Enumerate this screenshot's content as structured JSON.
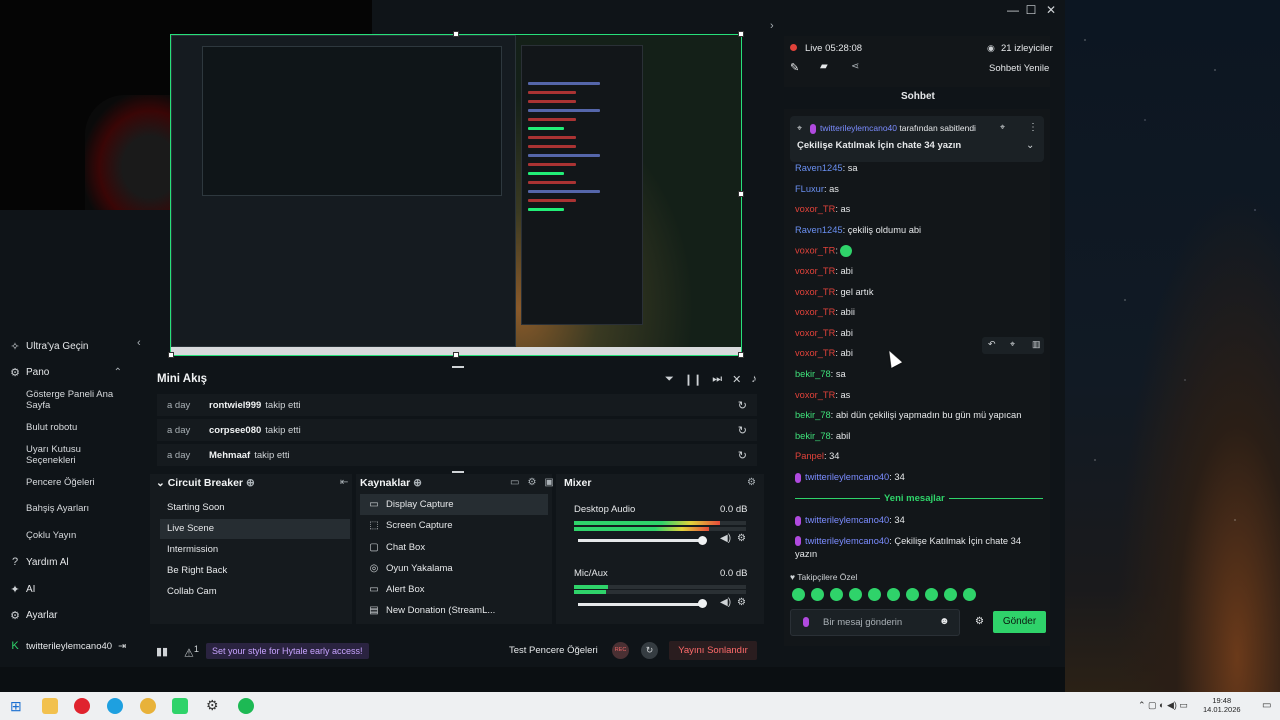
{
  "window": {
    "minimize": "—",
    "maximize": "☐",
    "close": "✕"
  },
  "sidebar": {
    "ultra": "Ultra'ya Geçin",
    "pano": "Pano",
    "sub_items": [
      "Gösterge Paneli Ana Sayfa",
      "Bulut robotu",
      "Uyarı Kutusu Seçenekleri",
      "Pencere Öğeleri",
      "Bahşiş Ayarları",
      "Çoklu Yayın"
    ],
    "help": "Yardım Al",
    "ai": "AI",
    "settings": "Ayarlar",
    "account": "twitterileylemcano40"
  },
  "mini_feed": {
    "title": "Mini Akış",
    "rows": [
      {
        "when": "a day",
        "user": "rontwiel999",
        "action": "takip etti"
      },
      {
        "when": "a day",
        "user": "corpsee080",
        "action": "takip etti"
      },
      {
        "when": "a day",
        "user": "Mehmaaf",
        "action": "takip etti"
      }
    ]
  },
  "scenes": {
    "title": "Circuit Breaker",
    "items": [
      "Starting Soon",
      "Live Scene",
      "Intermission",
      "Be Right Back",
      "Collab Cam"
    ],
    "active": "Live Scene"
  },
  "sources": {
    "title": "Kaynaklar",
    "items": [
      "Display Capture",
      "Screen Capture",
      "Chat Box",
      "Oyun Yakalama",
      "Alert Box",
      "New Donation (StreamL..."
    ]
  },
  "mixer": {
    "title": "Mixer",
    "channels": [
      {
        "name": "Desktop Audio",
        "db": "0.0 dB",
        "level": 0.85,
        "volume": 0.88
      },
      {
        "name": "Mic/Aux",
        "db": "0.0 dB",
        "level": 0.2,
        "volume": 0.88
      }
    ]
  },
  "status": {
    "promo": "Set your style for Hytale early access!",
    "alerts_count": "1",
    "test_widgets": "Test Pencere Öğeleri",
    "rec": "REC",
    "end_stream": "Yayını Sonlandır"
  },
  "chat": {
    "live": "Live 05:28:08",
    "viewers": "21 izleyiciler",
    "refresh": "Sohbeti Yenile",
    "tab": "Sohbet",
    "pinned_by": "twitterileylemcano40",
    "pinned_suffix": "tarafından sabitlendi",
    "pinned_text": "Çekilişe Katılmak İçin chate 34 yazın",
    "new_messages": "Yeni mesajlar",
    "follower_only": "Takipçilere Özel",
    "input_placeholder": "Bir mesaj gönderin",
    "send": "Gönder",
    "messages": [
      {
        "user": "Raven1245",
        "text": ": sa",
        "color": "#6a8ff0"
      },
      {
        "user": "FLuxur",
        "text": ": as",
        "color": "#6a8ff0"
      },
      {
        "user": "voxor_TR",
        "text": ": as",
        "color": "#e0423a"
      },
      {
        "user": "Raven1245",
        "text": ": çekiliş oldumu abi",
        "color": "#6a8ff0"
      },
      {
        "user": "voxor_TR",
        "text": ": ",
        "color": "#e0423a"
      },
      {
        "user": "voxor_TR",
        "text": ": abi",
        "color": "#e0423a"
      },
      {
        "user": "voxor_TR",
        "text": ": gel artık",
        "color": "#e0423a"
      },
      {
        "user": "voxor_TR",
        "text": ": abii",
        "color": "#e0423a"
      },
      {
        "user": "voxor_TR",
        "text": ": abi",
        "color": "#e0423a"
      },
      {
        "user": "voxor_TR",
        "text": ": abi",
        "color": "#e0423a"
      },
      {
        "user": "bekir_78",
        "text": ": sa",
        "color": "#3fe07a"
      },
      {
        "user": "voxor_TR",
        "text": ": as",
        "color": "#e0423a"
      },
      {
        "user": "bekir_78",
        "text": ": abi dün çekilişi yapmadın bu gün mü yapıcan",
        "color": "#3fe07a"
      },
      {
        "user": "bekir_78",
        "text": ": abil",
        "color": "#3fe07a"
      },
      {
        "user": "Panpel",
        "text": ": 34",
        "color": "#e0423a"
      },
      {
        "user": "twitterileylemcano40",
        "text": ": 34",
        "color": "#7b8cff"
      }
    ],
    "after_new": [
      {
        "user": "twitterileylemcano40",
        "text": ": 34",
        "color": "#7b8cff"
      },
      {
        "user": "twitterileylemcano40",
        "text": ": Çekilişe Katılmak İçin chate 34",
        "color": "#7b8cff"
      }
    ],
    "wrap": "yazın"
  },
  "taskbar": {
    "time": "19:48",
    "date": "14.01.2026"
  }
}
